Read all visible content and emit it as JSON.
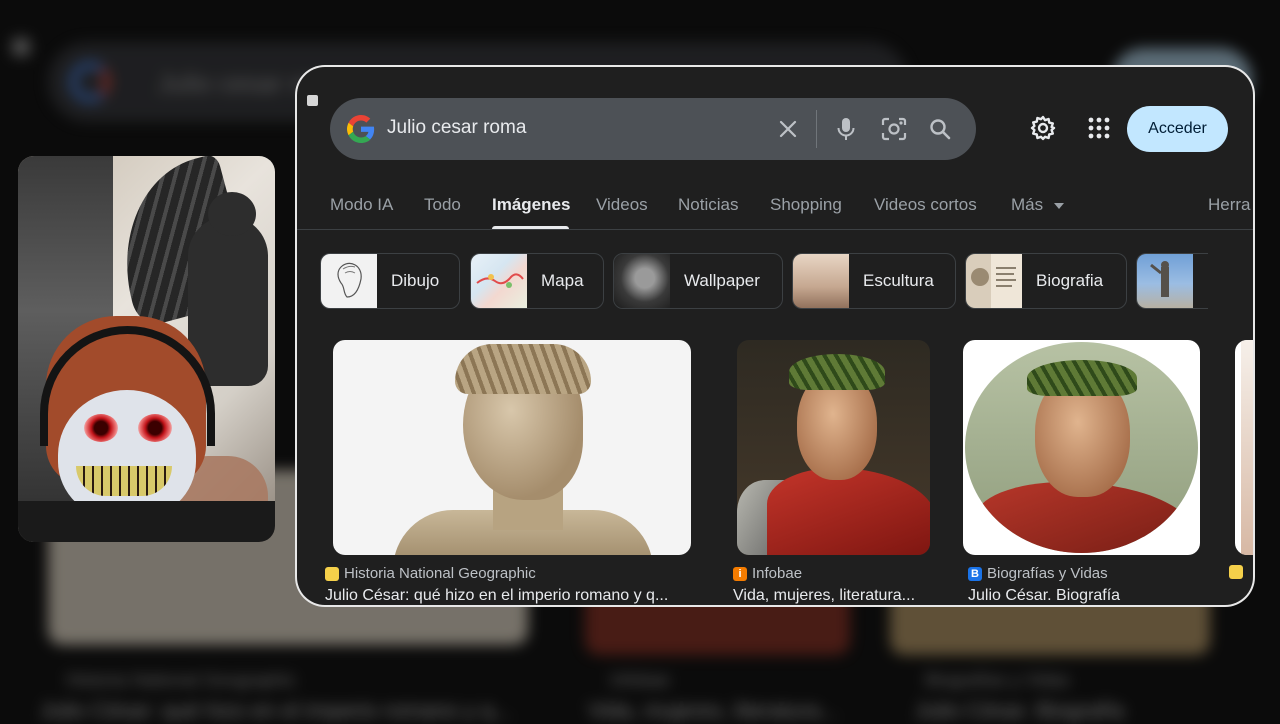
{
  "search": {
    "query": "Julio cesar roma"
  },
  "header": {
    "signin_label": "Acceder"
  },
  "tabs": [
    {
      "label": "Modo IA"
    },
    {
      "label": "Todo"
    },
    {
      "label": "Imágenes",
      "active": true
    },
    {
      "label": "Videos"
    },
    {
      "label": "Noticias"
    },
    {
      "label": "Shopping"
    },
    {
      "label": "Videos cortos"
    },
    {
      "label": "Más"
    },
    {
      "label": "Herra"
    }
  ],
  "chips": [
    {
      "label": "Dibujo"
    },
    {
      "label": "Mapa"
    },
    {
      "label": "Wallpaper"
    },
    {
      "label": "Escultura"
    },
    {
      "label": "Biografia"
    },
    {
      "label": ""
    }
  ],
  "results": [
    {
      "source": "Historia National Geographic",
      "title": "Julio César: qué hizo en el imperio romano y q...",
      "favicon_color": "#f5d04a"
    },
    {
      "source": "Infobae",
      "title": "Vida, mujeres, literatura...",
      "favicon_color": "#f57c00"
    },
    {
      "source": "Biografías y Vidas",
      "title": "Julio César. Biografía",
      "favicon_color": "#1a73e8"
    },
    {
      "source": "",
      "title": "",
      "favicon_color": "#f5d04a"
    }
  ],
  "background_page": {
    "query": "Julio cesar roma",
    "results": [
      {
        "source": "Historia National Geographic",
        "title": "Julio César: qué hizo en el imperio romano y q..."
      },
      {
        "source": "Infobae",
        "title": "Vida, mujeres, literatura..."
      },
      {
        "source": "Biografías y Vidas",
        "title": "Julio César. Biografía"
      }
    ]
  },
  "icons": {
    "clear": "close-icon",
    "voice": "mic-icon",
    "lens": "camera-lens-icon",
    "search": "search-icon",
    "settings": "gear-icon",
    "apps": "apps-grid-icon"
  },
  "colors": {
    "accent_button": "#c2e7ff",
    "background": "#1f1f1f",
    "searchbar": "#4d5156"
  }
}
